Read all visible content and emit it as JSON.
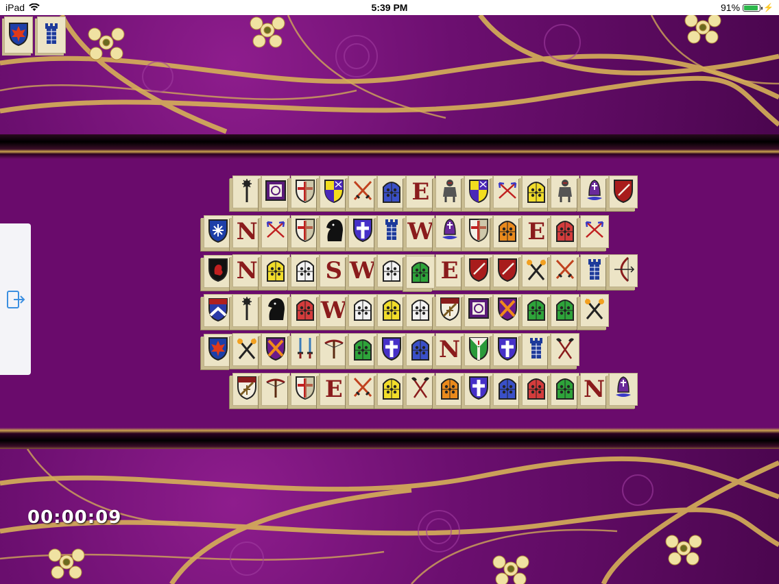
{
  "status_bar": {
    "device": "iPad",
    "time": "5:39 PM",
    "battery": "91%",
    "battery_level": 0.91
  },
  "colors": {
    "felt": "#6a0b6c",
    "tile_face": "#ece4c6",
    "gold": "#caa24f",
    "letter_red": "#8a1c1c"
  },
  "collected_tiles": [
    "shield-maple-icon",
    "tower-icon"
  ],
  "exit_button": {
    "icon": "exit-icon"
  },
  "timer": "00:00:09",
  "tiles": [
    {
      "c": 0,
      "r": 1,
      "kind": "shield-snowflake-icon"
    },
    {
      "c": 0,
      "r": 2,
      "kind": "shield-lion-icon"
    },
    {
      "c": 0,
      "r": 3,
      "kind": "shield-chevron-icon"
    },
    {
      "c": 0,
      "r": 4,
      "kind": "shield-maple-icon"
    },
    {
      "c": 1,
      "r": 0,
      "kind": "mace-icon"
    },
    {
      "c": 1,
      "r": 1,
      "kind": "letter",
      "text": "N"
    },
    {
      "c": 1,
      "r": 2,
      "kind": "letter",
      "text": "N"
    },
    {
      "c": 1,
      "r": 3,
      "kind": "mace-icon"
    },
    {
      "c": 1,
      "r": 4,
      "kind": "crossed-torches-icon"
    },
    {
      "c": 1,
      "r": 5,
      "kind": "shield-crest-icon"
    },
    {
      "c": 2,
      "r": 0,
      "kind": "square-emblem-icon"
    },
    {
      "c": 2,
      "r": 1,
      "kind": "crossed-arrows-icon"
    },
    {
      "c": 2,
      "r": 2,
      "kind": "window-yellow-icon"
    },
    {
      "c": 2,
      "r": 3,
      "kind": "knight-horse-icon"
    },
    {
      "c": 2,
      "r": 4,
      "kind": "shield-saltire-icon"
    },
    {
      "c": 2,
      "r": 5,
      "kind": "crossbow-icon"
    },
    {
      "c": 3,
      "r": 0,
      "kind": "shield-cross-icon"
    },
    {
      "c": 3,
      "r": 1,
      "kind": "shield-cross-icon"
    },
    {
      "c": 3,
      "r": 2,
      "kind": "window-white-icon"
    },
    {
      "c": 3,
      "r": 3,
      "kind": "window-red-icon"
    },
    {
      "c": 3,
      "r": 4,
      "kind": "daggers-icon"
    },
    {
      "c": 3,
      "r": 5,
      "kind": "shield-cross-icon"
    },
    {
      "c": 4,
      "r": 0,
      "kind": "shield-quartered-icon"
    },
    {
      "c": 4,
      "r": 1,
      "kind": "knight-horse-icon"
    },
    {
      "c": 4,
      "r": 2,
      "kind": "letter",
      "text": "S"
    },
    {
      "c": 4,
      "r": 3,
      "kind": "letter",
      "text": "W"
    },
    {
      "c": 4,
      "r": 4,
      "kind": "crossbow-icon"
    },
    {
      "c": 4,
      "r": 5,
      "kind": "letter",
      "text": "E"
    },
    {
      "c": 5,
      "r": 0,
      "kind": "crossed-swords-icon"
    },
    {
      "c": 5,
      "r": 1,
      "kind": "shield-cross-blue-icon"
    },
    {
      "c": 5,
      "r": 2,
      "kind": "letter",
      "text": "W"
    },
    {
      "c": 5,
      "r": 3,
      "kind": "window-white-icon"
    },
    {
      "c": 5,
      "r": 4,
      "kind": "window-green-icon"
    },
    {
      "c": 5,
      "r": 5,
      "kind": "crossed-swords-icon"
    },
    {
      "c": 6,
      "r": 0,
      "kind": "window-blue-icon"
    },
    {
      "c": 6,
      "r": 1,
      "kind": "tower-icon"
    },
    {
      "c": 6,
      "r": 2,
      "kind": "window-white-icon"
    },
    {
      "c": 6,
      "r": 3,
      "kind": "window-yellow-icon"
    },
    {
      "c": 6,
      "r": 4,
      "kind": "shield-cross-blue-icon"
    },
    {
      "c": 6,
      "r": 5,
      "kind": "window-yellow-icon"
    },
    {
      "c": 7,
      "r": 0,
      "kind": "letter",
      "text": "E"
    },
    {
      "c": 7,
      "r": 1,
      "kind": "letter",
      "text": "W"
    },
    {
      "c": 7,
      "r": 2,
      "kind": "window-green-icon"
    },
    {
      "c": 7,
      "r": 3,
      "kind": "window-white-icon"
    },
    {
      "c": 7,
      "r": 4,
      "kind": "window-blue-icon"
    },
    {
      "c": 7,
      "r": 5,
      "kind": "axes-icon"
    },
    {
      "c": 8,
      "r": 0,
      "kind": "knight-armor-icon"
    },
    {
      "c": 8,
      "r": 1,
      "kind": "bishop-icon"
    },
    {
      "c": 8,
      "r": 2,
      "kind": "letter",
      "text": "E"
    },
    {
      "c": 8,
      "r": 3,
      "kind": "shield-crest-icon"
    },
    {
      "c": 8,
      "r": 4,
      "kind": "letter",
      "text": "N"
    },
    {
      "c": 8,
      "r": 5,
      "kind": "window-orange-icon"
    },
    {
      "c": 9,
      "r": 0,
      "kind": "shield-quartered-icon"
    },
    {
      "c": 9,
      "r": 1,
      "kind": "shield-cross-icon"
    },
    {
      "c": 9,
      "r": 2,
      "kind": "shield-bend-icon"
    },
    {
      "c": 9,
      "r": 3,
      "kind": "square-emblem-icon"
    },
    {
      "c": 9,
      "r": 4,
      "kind": "shield-pall-icon"
    },
    {
      "c": 9,
      "r": 5,
      "kind": "shield-cross-blue-icon"
    },
    {
      "c": 10,
      "r": 0,
      "kind": "crossed-arrows-icon"
    },
    {
      "c": 10,
      "r": 1,
      "kind": "window-orange-icon"
    },
    {
      "c": 10,
      "r": 2,
      "kind": "shield-bend-icon"
    },
    {
      "c": 10,
      "r": 3,
      "kind": "shield-saltire-icon"
    },
    {
      "c": 10,
      "r": 4,
      "kind": "shield-cross-blue-icon"
    },
    {
      "c": 10,
      "r": 5,
      "kind": "window-blue-icon"
    },
    {
      "c": 11,
      "r": 0,
      "kind": "window-yellow-icon"
    },
    {
      "c": 11,
      "r": 1,
      "kind": "letter",
      "text": "E"
    },
    {
      "c": 11,
      "r": 2,
      "kind": "crossed-torches-icon"
    },
    {
      "c": 11,
      "r": 3,
      "kind": "window-green-icon"
    },
    {
      "c": 11,
      "r": 4,
      "kind": "tower-icon"
    },
    {
      "c": 11,
      "r": 5,
      "kind": "window-red-icon"
    },
    {
      "c": 12,
      "r": 0,
      "kind": "knight-armor-icon"
    },
    {
      "c": 12,
      "r": 1,
      "kind": "window-red-icon"
    },
    {
      "c": 12,
      "r": 2,
      "kind": "crossed-swords-icon"
    },
    {
      "c": 12,
      "r": 3,
      "kind": "window-green-icon"
    },
    {
      "c": 12,
      "r": 4,
      "kind": "axes-icon"
    },
    {
      "c": 12,
      "r": 5,
      "kind": "window-green-icon"
    },
    {
      "c": 13,
      "r": 0,
      "kind": "bishop-icon"
    },
    {
      "c": 13,
      "r": 1,
      "kind": "crossed-arrows-icon"
    },
    {
      "c": 13,
      "r": 2,
      "kind": "tower-icon"
    },
    {
      "c": 13,
      "r": 3,
      "kind": "crossed-torches-icon"
    },
    {
      "c": 13,
      "r": 5,
      "kind": "letter",
      "text": "N"
    },
    {
      "c": 14,
      "r": 0,
      "kind": "shield-bend-icon"
    },
    {
      "c": 14,
      "r": 2,
      "kind": "bow-icon"
    },
    {
      "c": 14,
      "r": 5,
      "kind": "bishop-icon"
    },
    {
      "c": 7,
      "r": 2,
      "layer": 2,
      "kind": "window-green-icon"
    }
  ]
}
